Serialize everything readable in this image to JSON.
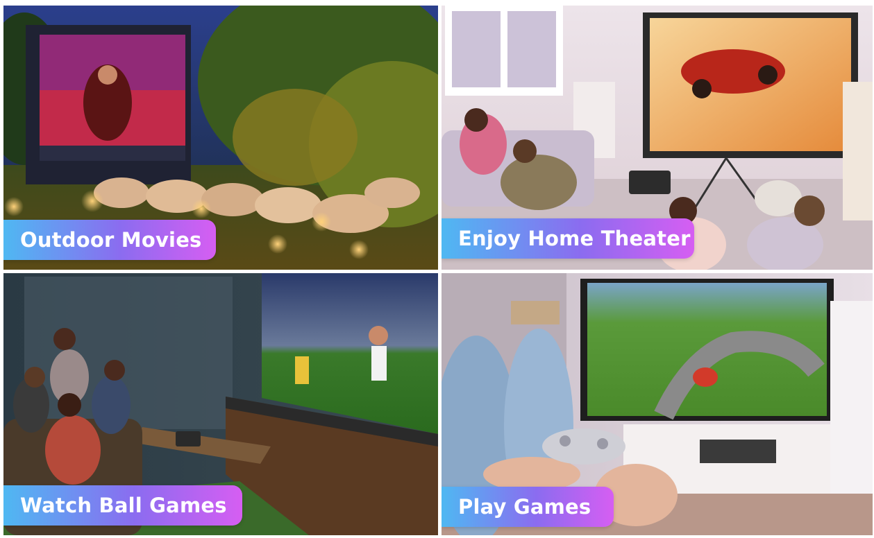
{
  "panels": [
    {
      "label": "Outdoor Movies"
    },
    {
      "label": "Enjoy Home Theater"
    },
    {
      "label": "Watch Ball Games"
    },
    {
      "label": "Play Games"
    }
  ],
  "colors": {
    "label_gradient_start": "#4fb8f2",
    "label_gradient_mid": "#8b6cf0",
    "label_gradient_end": "#d65ef2",
    "label_text": "#ffffff"
  }
}
